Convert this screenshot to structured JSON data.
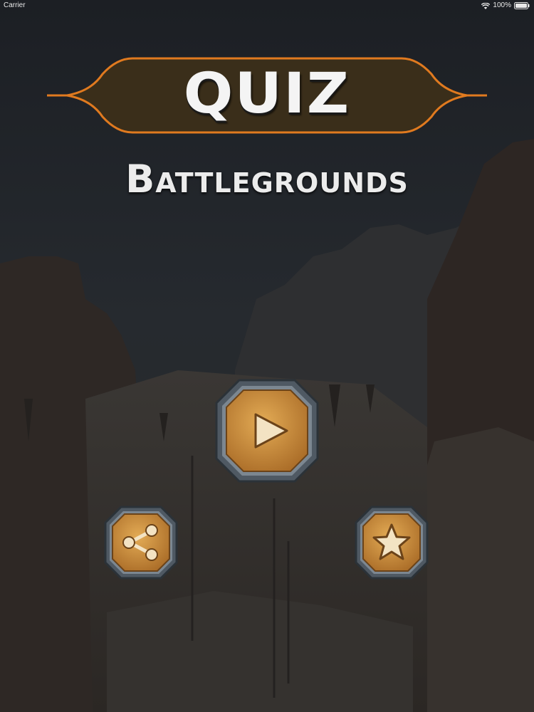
{
  "status_bar": {
    "carrier": "Carrier",
    "battery": "100%",
    "wifi_icon": "wifi-icon",
    "battery_icon": "battery-icon"
  },
  "title": {
    "main": "QUIZ",
    "subtitle": "Battlegrounds"
  },
  "buttons": {
    "play_icon": "play-icon",
    "share_icon": "share-icon",
    "rate_icon": "star-icon"
  },
  "colors": {
    "banner_border": "#e07a1f",
    "banner_fill": "#3a2e1a",
    "button_wood": "#c98f3e",
    "button_frame": "#5c6670",
    "icon_fill": "#f3e3c3"
  }
}
